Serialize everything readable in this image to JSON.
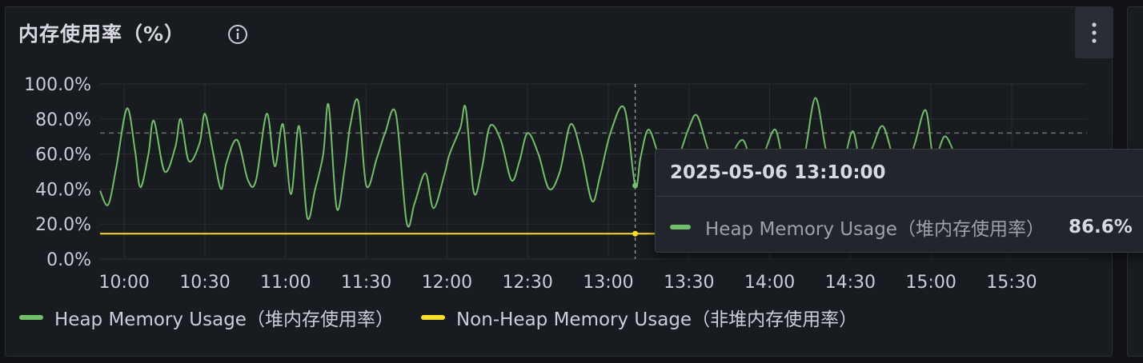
{
  "panel": {
    "title": "内存使用率（%）"
  },
  "tooltip": {
    "time": "2025-05-06 13:10:00",
    "series_name": "Heap Memory Usage（堆内存使用率）",
    "value": "86.6%",
    "color": "#73bf69"
  },
  "colors": {
    "heap": "#73bf69",
    "nonheap": "#fade2a",
    "panel_bg": "#181b1f",
    "grid": "#2c2e33"
  },
  "chart_data": {
    "type": "line",
    "title": "内存使用率（%）",
    "x_ticks": [
      "10:00",
      "10:30",
      "11:00",
      "11:30",
      "12:00",
      "12:30",
      "13:00",
      "13:30",
      "14:00",
      "14:30",
      "15:00",
      "15:30"
    ],
    "y_ticks": [
      "0.0%",
      "20.0%",
      "40.0%",
      "60.0%",
      "80.0%",
      "100.0%"
    ],
    "ylim": [
      0,
      100
    ],
    "xlim": [
      "09:51",
      "15:58"
    ],
    "threshold": 72,
    "hover_time": "13:10",
    "series": [
      {
        "name": "Heap Memory Usage（堆内存使用率）",
        "color": "#73bf69",
        "x": [
          "09:51",
          "09:54",
          "09:57",
          "10:01",
          "10:04",
          "10:06",
          "10:09",
          "10:11",
          "10:15",
          "10:19",
          "10:21",
          "10:24",
          "10:28",
          "10:30",
          "10:33",
          "10:36",
          "10:38",
          "10:42",
          "10:46",
          "10:49",
          "10:53",
          "10:56",
          "10:59",
          "11:02",
          "11:05",
          "11:08",
          "11:11",
          "11:14",
          "11:16",
          "11:19",
          "11:22",
          "11:24",
          "11:27",
          "11:30",
          "11:34",
          "11:37",
          "11:41",
          "11:45",
          "11:48",
          "11:52",
          "11:55",
          "11:59",
          "12:01",
          "12:05",
          "12:07",
          "12:10",
          "12:13",
          "12:16",
          "12:20",
          "12:24",
          "12:27",
          "12:30",
          "12:34",
          "12:38",
          "12:42",
          "12:46",
          "12:50",
          "12:54",
          "12:57",
          "13:01",
          "13:06",
          "13:10",
          "13:12",
          "13:15",
          "13:19",
          "13:23",
          "13:27",
          "13:30",
          "13:33",
          "13:37",
          "13:41",
          "13:45",
          "13:50",
          "13:54",
          "13:58",
          "14:02",
          "14:05",
          "14:09",
          "14:13",
          "14:17",
          "14:21",
          "14:25",
          "14:28",
          "14:31",
          "14:34",
          "14:38",
          "14:42",
          "14:46",
          "14:50",
          "14:54",
          "14:58",
          "15:01",
          "15:05",
          "15:08",
          "15:12",
          "15:15",
          "15:19",
          "15:23",
          "15:26",
          "15:30",
          "15:33",
          "15:37",
          "15:41",
          "15:44",
          "15:48",
          "15:52",
          "15:55",
          "15:58"
        ],
        "y": [
          39,
          31,
          52,
          86,
          62,
          41,
          60,
          79,
          50,
          64,
          80,
          56,
          66,
          83,
          61,
          40,
          55,
          68,
          45,
          45,
          83,
          53,
          77,
          37,
          76,
          24,
          40,
          60,
          88,
          29,
          52,
          76,
          90,
          42,
          58,
          72,
          83,
          21,
          32,
          49,
          29,
          48,
          60,
          75,
          86,
          38,
          52,
          76,
          68,
          45,
          56,
          72,
          60,
          40,
          50,
          77,
          60,
          33,
          48,
          73,
          86,
          42,
          58,
          74,
          58,
          47,
          62,
          75,
          82,
          63,
          49,
          57,
          68,
          52,
          61,
          74,
          57,
          48,
          60,
          92,
          62,
          45,
          58,
          73,
          54,
          63,
          76,
          58,
          48,
          66,
          85,
          58,
          70,
          63,
          0,
          0,
          0,
          0,
          0,
          0,
          0,
          0,
          0,
          0,
          0,
          0,
          0,
          0
        ]
      },
      {
        "name": "Non-Heap Memory Usage（非堆内存使用率）",
        "color": "#fade2a",
        "x": [
          "09:51",
          "15:58"
        ],
        "y": [
          14.5,
          14.5
        ]
      }
    ]
  },
  "legend": {
    "items": [
      {
        "label": "Heap Memory Usage（堆内存使用率）",
        "color": "#73bf69"
      },
      {
        "label": "Non-Heap Memory Usage（非堆内存使用率）",
        "color": "#fade2a"
      }
    ]
  }
}
